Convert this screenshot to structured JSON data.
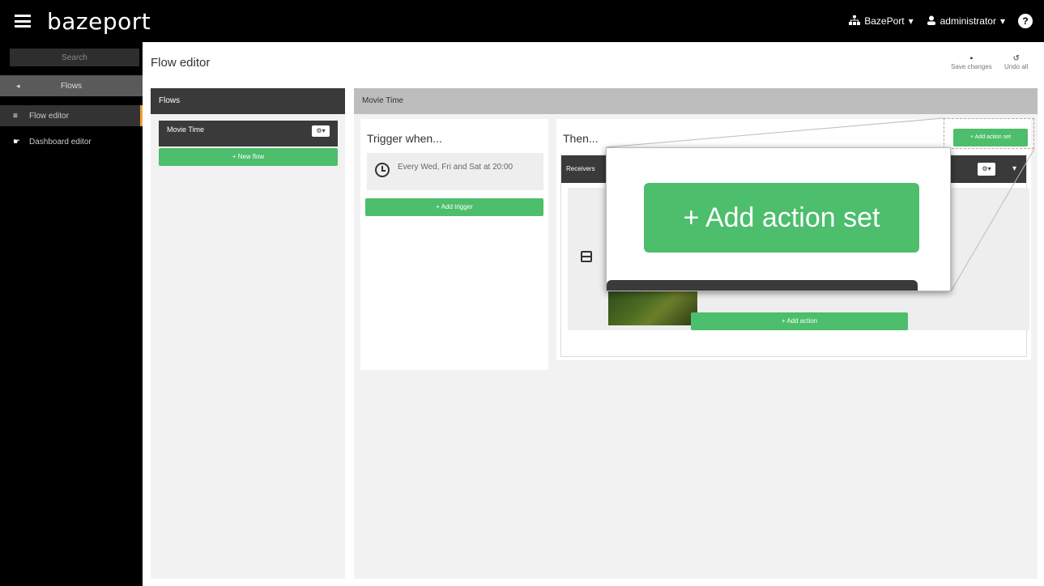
{
  "app": {
    "brand": "bazeport",
    "org_menu": "BazePort",
    "user_menu": "administrator",
    "caret": "▾",
    "help": "?"
  },
  "sidebar": {
    "search_placeholder": "Search",
    "back_label": "Flows",
    "items": [
      {
        "label": "Flow editor",
        "icon": "list-icon",
        "active": true
      },
      {
        "label": "Dashboard editor",
        "icon": "pointer-icon",
        "active": false
      }
    ]
  },
  "header": {
    "title": "Flow editor",
    "save_label": "Save changes",
    "undo_label": "Undo all"
  },
  "flows": {
    "header": "Flows",
    "items": [
      {
        "label": "Movie Time"
      }
    ],
    "new_flow": "+ New flow",
    "gear": "⚙▾"
  },
  "editor": {
    "header": "Movie Time",
    "trigger_title": "Trigger when...",
    "trigger_text": "Every Wed, Fri and Sat at 20:00",
    "add_trigger": "+ Add trigger",
    "then_title": "Then...",
    "add_action_set": "+ Add action set",
    "action_set_label": "Receivers",
    "add_action": "+ Add action",
    "gear": "⚙▾",
    "caret": "▾"
  },
  "zoom": {
    "label": "+ Add action set"
  },
  "colors": {
    "accent_green": "#4cbe6c",
    "active_marker": "#f0a030"
  }
}
